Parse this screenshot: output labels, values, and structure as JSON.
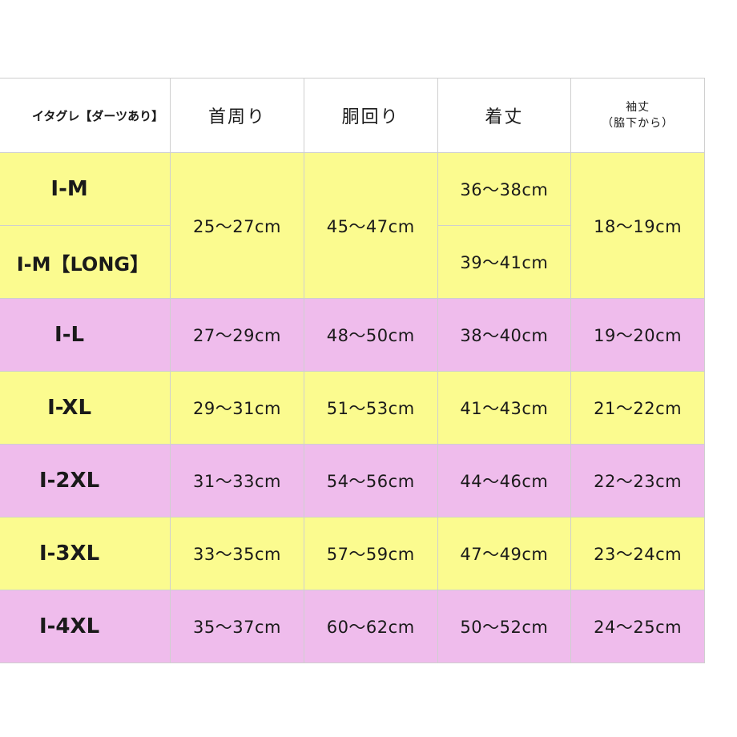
{
  "header": {
    "corner": "イタグレ【ダーツあり】",
    "neck": "首周り",
    "chest": "胴回り",
    "length": "着丈",
    "sleeve_line1": "袖丈",
    "sleeve_line2": "（脇下から）"
  },
  "rows": [
    {
      "size": "I-M",
      "neck": "25〜27cm",
      "chest": "45〜47cm",
      "length": "36〜38cm",
      "sleeve": "18〜19cm"
    },
    {
      "size": "I-M【LONG】",
      "length": "39〜41cm"
    },
    {
      "size": "I-L",
      "neck": "27〜29cm",
      "chest": "48〜50cm",
      "length": "38〜40cm",
      "sleeve": "19〜20cm"
    },
    {
      "size": "I-XL",
      "neck": "29〜31cm",
      "chest": "51〜53cm",
      "length": "41〜43cm",
      "sleeve": "21〜22cm"
    },
    {
      "size": "I-2XL",
      "neck": "31〜33cm",
      "chest": "54〜56cm",
      "length": "44〜46cm",
      "sleeve": "22〜23cm"
    },
    {
      "size": "I-3XL",
      "neck": "33〜35cm",
      "chest": "57〜59cm",
      "length": "47〜49cm",
      "sleeve": "23〜24cm"
    },
    {
      "size": "I-4XL",
      "neck": "35〜37cm",
      "chest": "60〜62cm",
      "length": "50〜52cm",
      "sleeve": "24〜25cm"
    }
  ],
  "colors": {
    "yellow_row": "#fbfb8f",
    "pink_row": "#efbcec",
    "border": "#cfcfcf"
  }
}
